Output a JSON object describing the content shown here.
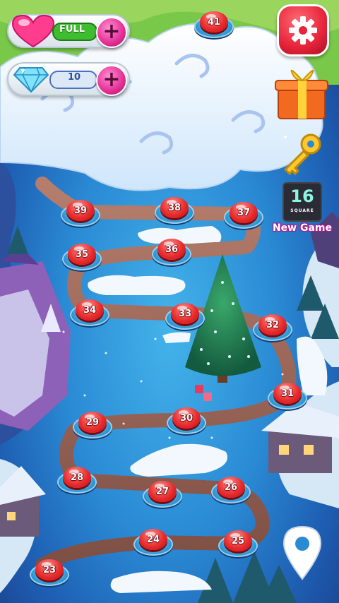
{
  "hud": {
    "lives": {
      "value": "FULL",
      "icon": "heart-icon"
    },
    "gems": {
      "value": "10",
      "icon": "diamond-icon"
    },
    "add_icon": "plus-icon"
  },
  "side_menu": {
    "settings_icon": "gear-icon",
    "gift_icon": "gift-icon",
    "key_icon": "key-icon",
    "promo": {
      "number": "16",
      "subtitle": "SQUARE",
      "label": "New Game"
    },
    "map_pin_icon": "map-pin-icon"
  },
  "levels": [
    {
      "n": "41"
    },
    {
      "n": "39"
    },
    {
      "n": "38"
    },
    {
      "n": "37"
    },
    {
      "n": "35"
    },
    {
      "n": "36"
    },
    {
      "n": "34"
    },
    {
      "n": "33"
    },
    {
      "n": "32"
    },
    {
      "n": "31"
    },
    {
      "n": "29"
    },
    {
      "n": "30"
    },
    {
      "n": "28"
    },
    {
      "n": "27"
    },
    {
      "n": "26"
    },
    {
      "n": "24"
    },
    {
      "n": "25"
    },
    {
      "n": "23"
    }
  ],
  "colors": {
    "level_button": "#e92b2b",
    "settings_button": "#e6243a",
    "plus_button": "#e8349a",
    "ice_water": "#3aa6e6"
  }
}
